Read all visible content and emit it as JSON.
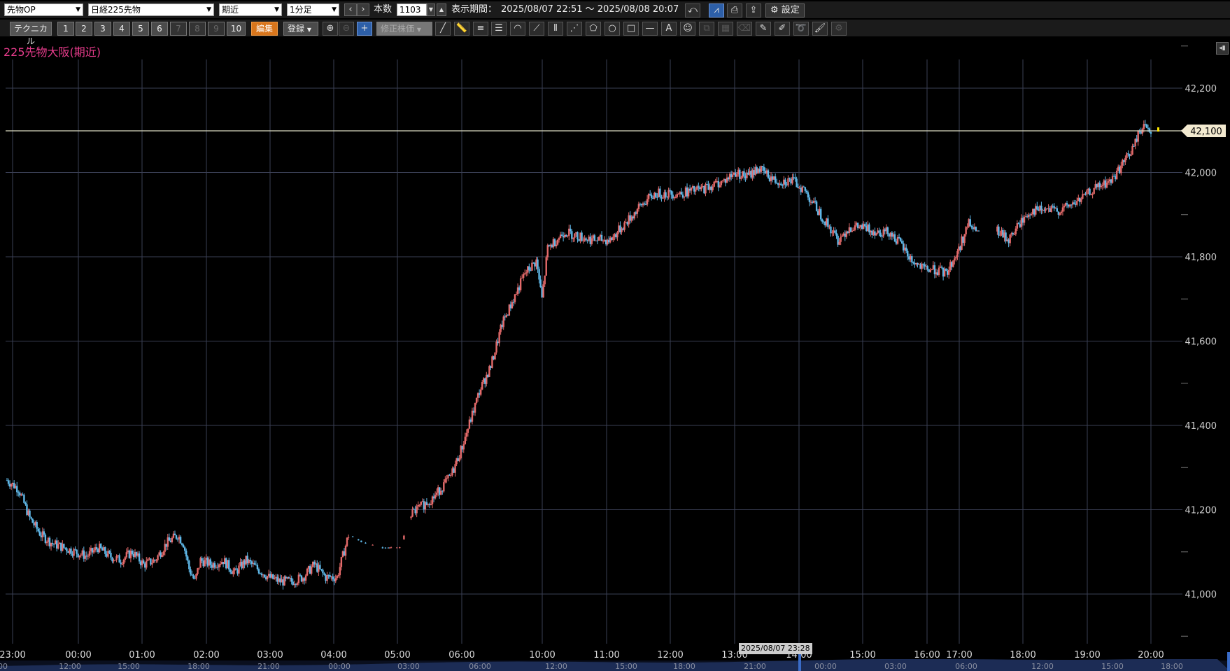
{
  "toolbar": {
    "category": "先物OP",
    "instrument": "日経225先物",
    "contract": "期近",
    "interval": "1分足",
    "bars_label": "本数",
    "bars_value": "1103",
    "period_label": "表示期間：",
    "period_value": "2025/08/07 22:51 ～ 2025/08/08 20:07",
    "settings_label": "設定",
    "technical_label": "テクニカル",
    "presets": [
      "1",
      "2",
      "3",
      "4",
      "5",
      "6",
      "7",
      "8",
      "9",
      "10"
    ],
    "edit_label": "編集",
    "register_label": "登録",
    "adjusted_label": "修正株価"
  },
  "chart_title": "225先物大阪(期近)",
  "hover_date": "2025/08/07 23:28",
  "colors": {
    "background": "#000000",
    "up": "#e46a6a",
    "down": "#5fb8e8",
    "grid": "#3a3f55",
    "title": "#e83c8c",
    "price_line": "#d9d9c0",
    "price_tag": "#f3ead0"
  },
  "icons": [
    "back-icon",
    "chart-style-icon",
    "print-icon",
    "export-icon",
    "gear-icon",
    "zoom-in-icon",
    "zoom-out-icon",
    "crosshair-icon",
    "trendline-icon",
    "ruler-icon",
    "hlines-icon",
    "hlines-dense-icon",
    "arc-icon",
    "fan-icon",
    "vlines-icon",
    "pitchfork-icon",
    "pentagon-icon",
    "circle-icon",
    "rectangle-icon",
    "hline-icon",
    "text-icon",
    "icon-stamp-icon",
    "copy-icon",
    "grid-icon",
    "eraser-icon",
    "pencil-icon",
    "pencil-alt-icon",
    "lasso-icon",
    "brush-icon",
    "settings-small-icon"
  ],
  "chart_data": {
    "type": "candlestick",
    "ylim": [
      40830,
      42300
    ],
    "y_ticks": [
      "41,000",
      "41,200",
      "41,400",
      "41,600",
      "41,800",
      "42,000",
      "42,200"
    ],
    "current_price": "42,100",
    "x_ticks": [
      "23:00",
      "00:00",
      "01:00",
      "02:00",
      "03:00",
      "04:00",
      "05:00",
      "06:00",
      "10:00",
      "11:00",
      "12:00",
      "13:00",
      "14:00",
      "15:00",
      "16:00",
      "17:00",
      "18:00",
      "19:00",
      "20:00"
    ],
    "nav_ticks": [
      "00",
      "12:00",
      "15:00",
      "18:00",
      "21:00",
      "00:00",
      "03:00",
      "06:00",
      "12:00",
      "15:00",
      "18:00",
      "21:00",
      "00:00",
      "03:00",
      "06:00",
      "12:00",
      "15:00",
      "18:00"
    ],
    "price_path": [
      [
        0,
        41270
      ],
      [
        4,
        41250
      ],
      [
        8,
        41180
      ],
      [
        12,
        41140
      ],
      [
        16,
        41120
      ],
      [
        20,
        41110
      ],
      [
        24,
        41100
      ],
      [
        28,
        41090
      ],
      [
        32,
        41110
      ],
      [
        36,
        41090
      ],
      [
        40,
        41080
      ],
      [
        44,
        41100
      ],
      [
        48,
        41070
      ],
      [
        52,
        41080
      ],
      [
        56,
        41120
      ],
      [
        60,
        41140
      ],
      [
        62,
        41120
      ],
      [
        64,
        41060
      ],
      [
        66,
        41030
      ],
      [
        68,
        41080
      ],
      [
        72,
        41070
      ],
      [
        76,
        41080
      ],
      [
        80,
        41050
      ],
      [
        84,
        41080
      ],
      [
        88,
        41060
      ],
      [
        92,
        41040
      ],
      [
        96,
        41030
      ],
      [
        100,
        41030
      ],
      [
        104,
        41040
      ],
      [
        108,
        41070
      ],
      [
        112,
        41040
      ],
      [
        116,
        41040
      ],
      [
        120,
        41140
      ],
      [
        126,
        41120
      ],
      [
        132,
        41110
      ],
      [
        138,
        41110
      ],
      [
        142,
        41190
      ],
      [
        150,
        41230
      ],
      [
        156,
        41280
      ],
      [
        160,
        41350
      ],
      [
        166,
        41480
      ],
      [
        170,
        41540
      ],
      [
        174,
        41640
      ],
      [
        178,
        41700
      ],
      [
        182,
        41760
      ],
      [
        186,
        41790
      ],
      [
        188,
        41700
      ],
      [
        190,
        41820
      ],
      [
        196,
        41860
      ],
      [
        200,
        41850
      ],
      [
        206,
        41840
      ],
      [
        212,
        41840
      ],
      [
        216,
        41870
      ],
      [
        220,
        41900
      ],
      [
        224,
        41930
      ],
      [
        228,
        41950
      ],
      [
        236,
        41950
      ],
      [
        244,
        41960
      ],
      [
        252,
        41980
      ],
      [
        256,
        42000
      ],
      [
        260,
        41990
      ],
      [
        264,
        42010
      ],
      [
        270,
        41980
      ],
      [
        276,
        41980
      ],
      [
        280,
        41960
      ],
      [
        284,
        41920
      ],
      [
        288,
        41880
      ],
      [
        292,
        41840
      ],
      [
        296,
        41870
      ],
      [
        300,
        41870
      ],
      [
        306,
        41860
      ],
      [
        310,
        41860
      ],
      [
        314,
        41830
      ],
      [
        318,
        41790
      ],
      [
        322,
        41770
      ],
      [
        326,
        41770
      ],
      [
        330,
        41760
      ],
      [
        334,
        41810
      ],
      [
        338,
        41880
      ],
      [
        340,
        41860
      ],
      [
        348,
        41860
      ],
      [
        352,
        41840
      ],
      [
        356,
        41880
      ],
      [
        360,
        41910
      ],
      [
        364,
        41910
      ],
      [
        370,
        41910
      ],
      [
        376,
        41930
      ],
      [
        382,
        41960
      ],
      [
        388,
        41980
      ],
      [
        392,
        42020
      ],
      [
        396,
        42060
      ],
      [
        398,
        42100
      ],
      [
        400,
        42110
      ],
      [
        402,
        42100
      ]
    ],
    "gaps": [
      [
        120,
        142
      ],
      [
        340,
        348
      ]
    ]
  }
}
